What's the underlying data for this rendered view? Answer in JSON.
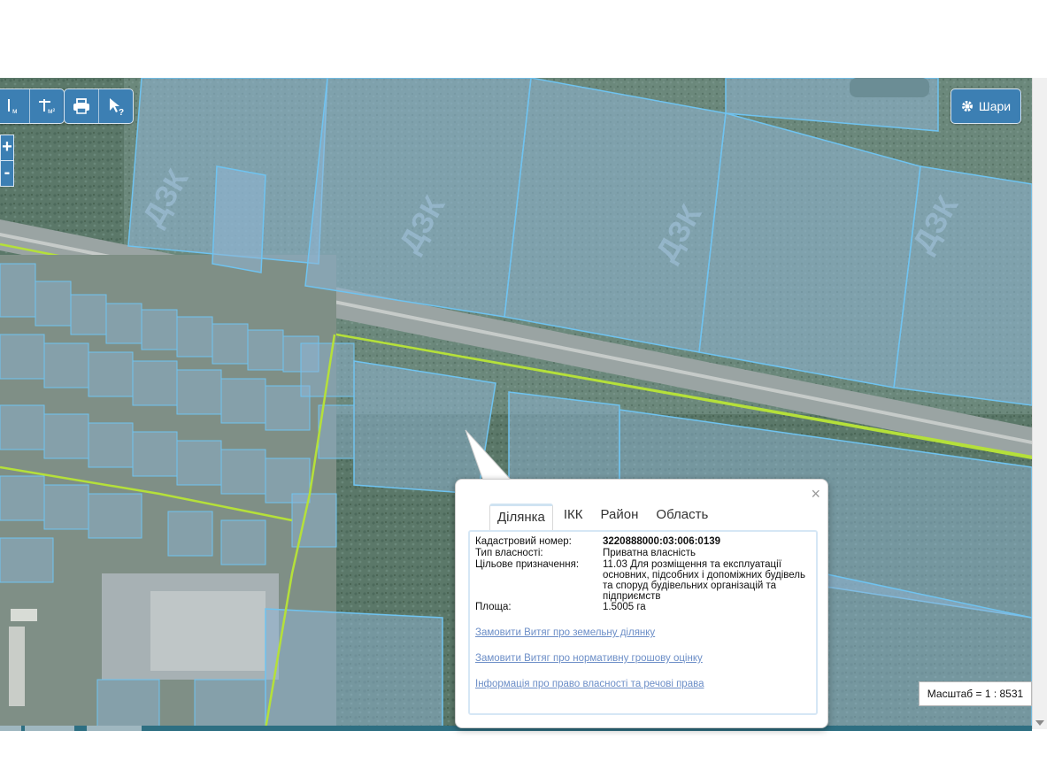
{
  "toolbar": {
    "measure_length_icon": "ruler-length-icon",
    "measure_area_icon": "ruler-area-icon",
    "print_icon": "printer-icon",
    "help_cursor_icon": "cursor-help-icon",
    "zoom_in_label": "+",
    "zoom_out_label": "-"
  },
  "layers_button": {
    "label": "Шари",
    "icon": "gear-icon"
  },
  "scale": {
    "label": "Масштаб = 1 : 8531"
  },
  "popup": {
    "close_label": "×",
    "tabs": [
      {
        "label": "Ділянка",
        "active": true
      },
      {
        "label": "ІКК",
        "active": false
      },
      {
        "label": "Район",
        "active": false
      },
      {
        "label": "Область",
        "active": false
      }
    ],
    "fields": {
      "cadastral_label": "Кадастровий номер:",
      "cadastral_value": "3220888000:03:006:0139",
      "ownership_label": "Тип власності:",
      "ownership_value": "Приватна власність",
      "purpose_label": "Цільове призначення:",
      "purpose_value": "11.03 Для розміщення та експлуатації основних, підсобних і допоміжних будівель та споруд будівельних організацій та підприємств",
      "area_label": "Площа:",
      "area_value": "1.5005 га"
    },
    "links": [
      {
        "label": "Замовити Витяг про земельну ділянку"
      },
      {
        "label": "Замовити Витяг про нормативну грошову оцінку"
      },
      {
        "label": "Інформація про право власності та речові права"
      }
    ]
  },
  "colors": {
    "parcel_fill": "#8fb6d6",
    "parcel_stroke": "#6fc3f0",
    "road_boundary": "#b5e03a",
    "button_bg": "#3c7fb3",
    "link": "#6c8ec7"
  }
}
